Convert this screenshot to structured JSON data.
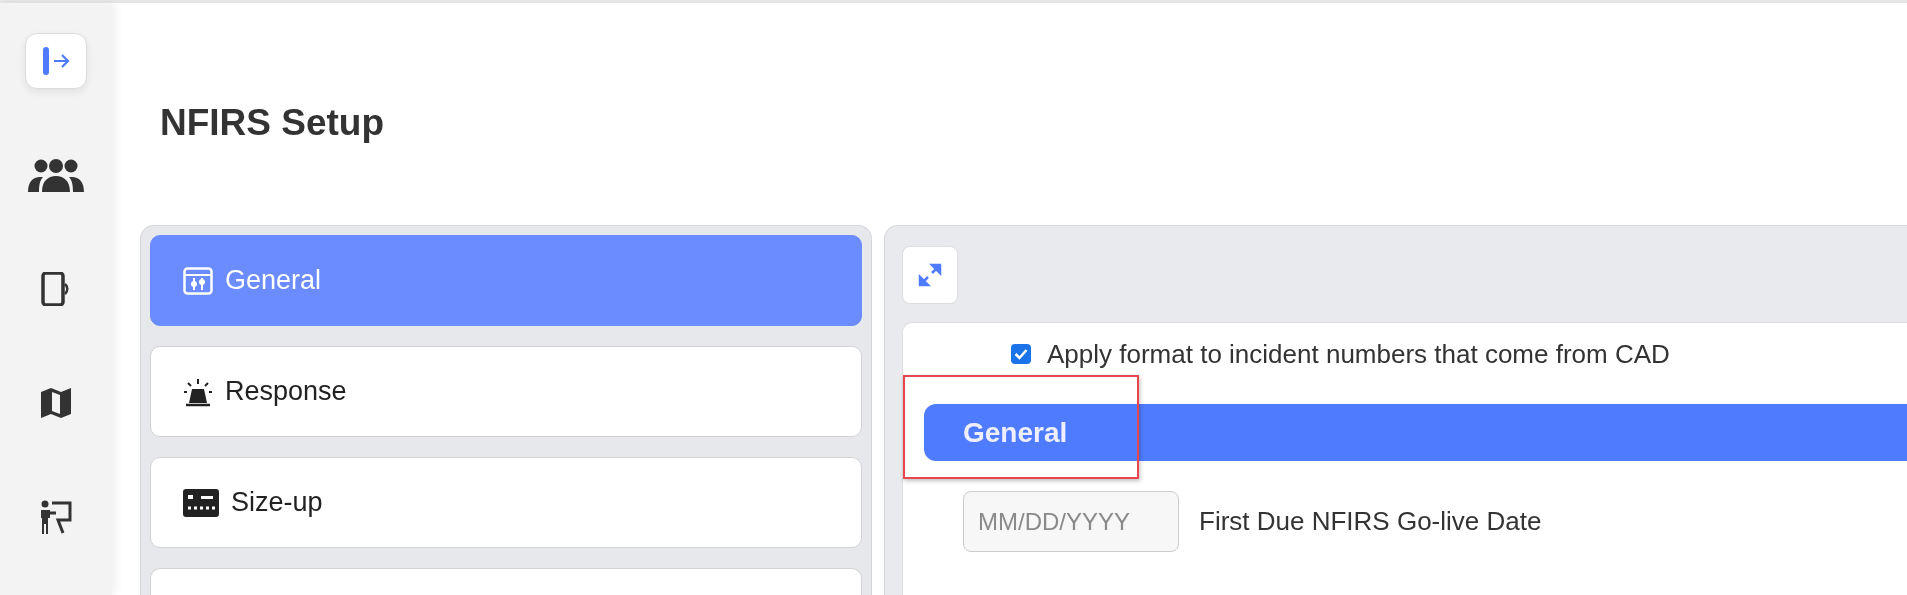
{
  "nav": [
    {
      "kind": "logout",
      "selected": true
    },
    {
      "kind": "people",
      "selected": false
    },
    {
      "kind": "phone",
      "selected": false
    },
    {
      "kind": "map",
      "selected": false
    },
    {
      "kind": "presenter",
      "selected": false
    }
  ],
  "title": "NFIRS Setup",
  "menu": [
    {
      "label": "General",
      "kind": "sliders",
      "selected": true
    },
    {
      "label": "Response",
      "kind": "siren",
      "selected": false
    },
    {
      "label": "Size-up",
      "kind": "panel",
      "selected": false
    }
  ],
  "content": {
    "checkbox": {
      "label": "Apply format to incident numbers that come from CAD",
      "checked": true
    },
    "section": {
      "title": "General",
      "highlighted": true
    },
    "date": {
      "placeholder": "MM/DD/YYYY",
      "label": "First Due NFIRS Go-live Date"
    }
  }
}
